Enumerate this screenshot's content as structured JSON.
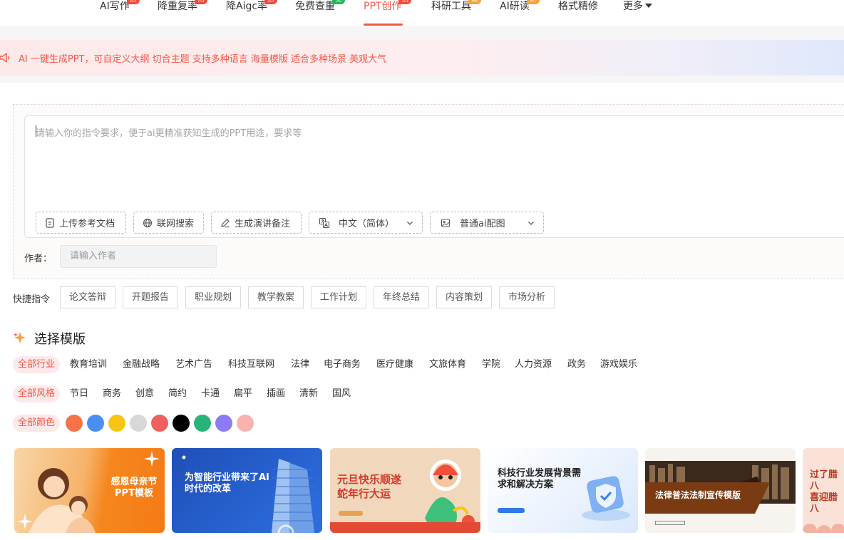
{
  "nav": {
    "items": [
      {
        "label": "AI写作",
        "badge": "热"
      },
      {
        "label": "降重复率",
        "badge": "热"
      },
      {
        "label": "降Aigc率",
        "badge": "热"
      },
      {
        "label": "免费查重",
        "badge": "免"
      },
      {
        "label": "PPT创作",
        "badge": "热"
      },
      {
        "label": "科研工具",
        "badge": "新"
      },
      {
        "label": "AI研读",
        "badge": "新"
      },
      {
        "label": "格式精修",
        "badge": ""
      },
      {
        "label": "更多",
        "badge": ""
      }
    ],
    "active": "PPT创作",
    "accent_color": "#f15a4a"
  },
  "banner": {
    "text": "AI 一键生成PPT，可自定义大纲 切合主题 支持多种语言 海量模版 适合多种场景 美观大气"
  },
  "prompt": {
    "placeholder": "请输入你的指令要求，便于ai更精准获知生成的PPT用途，要求等",
    "value": ""
  },
  "tools": {
    "upload": "上传参考文档",
    "web_search": "联网搜索",
    "speaker_notes": "生成演讲备注",
    "language": "中文（简体）",
    "image_mode": "普通ai配图"
  },
  "author": {
    "label": "作者：",
    "placeholder": "请输入作者"
  },
  "quick": {
    "label": "快捷指令",
    "items": [
      "论文答辩",
      "开题报告",
      "职业规划",
      "教学教案",
      "工作计划",
      "年终总结",
      "内容策划",
      "市场分析"
    ]
  },
  "templates": {
    "title": "选择模版",
    "industries": [
      "全部行业",
      "教育培训",
      "金融战略",
      "艺术广告",
      "科技互联网",
      "法律",
      "电子商务",
      "医疗健康",
      "文旅体育",
      "学院",
      "人力资源",
      "政务",
      "游戏娱乐"
    ],
    "styles": [
      "全部风格",
      "节日",
      "商务",
      "创意",
      "简约",
      "卡通",
      "扁平",
      "插画",
      "清新",
      "国风"
    ],
    "colors_label": "全部颜色",
    "colors": [
      "#f4744a",
      "#4a8ef4",
      "#f7c514",
      "#d8d8d8",
      "#f0605c",
      "#000000",
      "#27b47a",
      "#8b7cf6",
      "#f9b3ae"
    ],
    "cards": [
      {
        "title": "感恩母亲节\nPPT模板"
      },
      {
        "title": "为智能行业带来了AI\n时代的改革"
      },
      {
        "title": "元旦快乐顺遂\n蛇年行大运"
      },
      {
        "title": "科技行业发展背景需\n求和解决方案"
      },
      {
        "title": "法律普法法制宣传模版"
      },
      {
        "title": "过了腊八\n喜迎腊八"
      }
    ]
  }
}
